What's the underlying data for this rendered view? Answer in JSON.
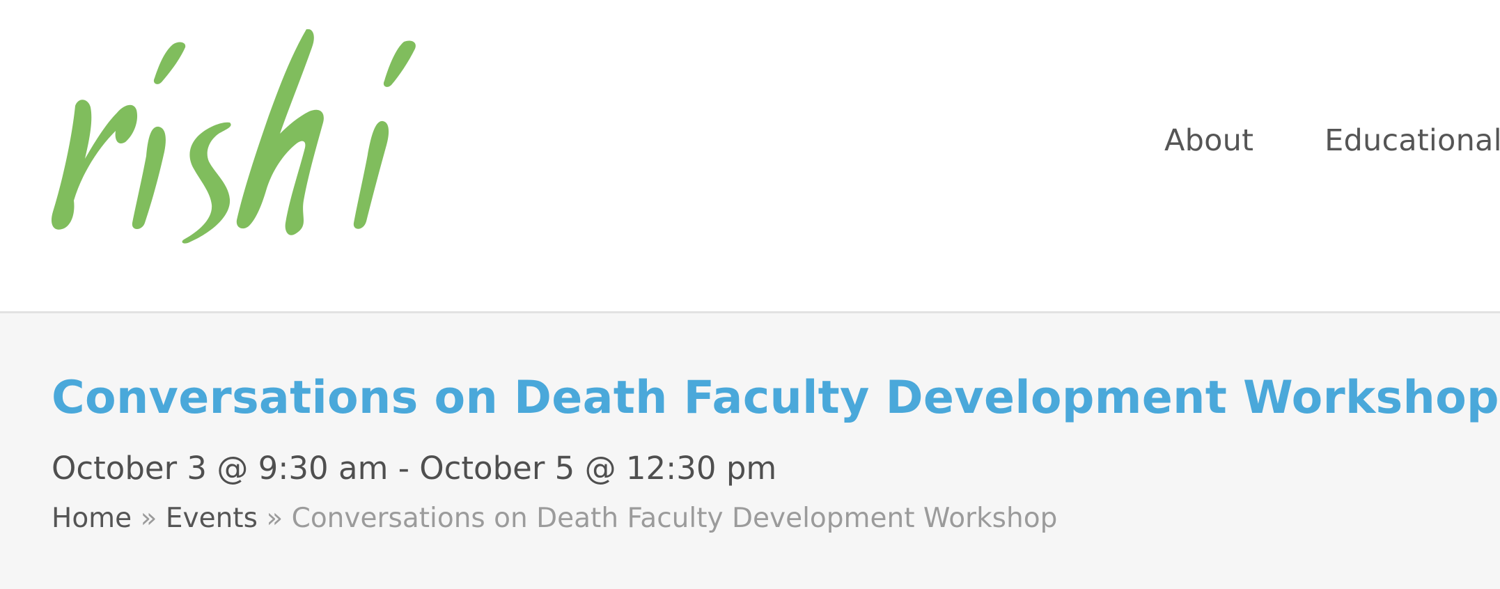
{
  "site": {
    "logo_text": "rishi",
    "logo_color": "#80bd5d"
  },
  "nav": {
    "items": [
      {
        "label": "About"
      },
      {
        "label": "Educational P"
      }
    ]
  },
  "event": {
    "title": "Conversations on Death Faculty Development Workshop",
    "dates": "October 3 @ 9:30 am - October 5 @ 12:30 pm"
  },
  "breadcrumb": {
    "home": "Home",
    "separator": "»",
    "events": "Events",
    "current": "Conversations on Death Faculty Development Workshop"
  },
  "colors": {
    "title": "#4aa8da",
    "text": "#555555",
    "muted": "#9b9b9b",
    "band": "#f6f6f6"
  }
}
